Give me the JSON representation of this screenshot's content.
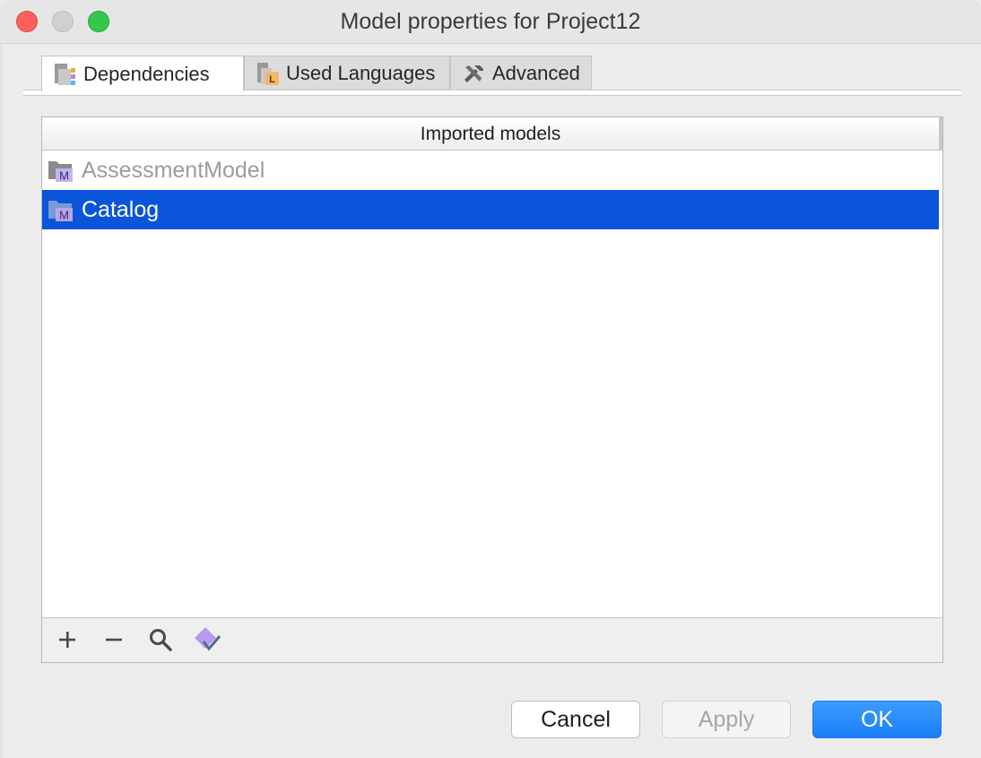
{
  "window": {
    "title": "Model properties for Project12"
  },
  "tabs": [
    {
      "label": "Dependencies",
      "icon": "dependencies-icon",
      "active": true
    },
    {
      "label": "Used Languages",
      "icon": "language-icon",
      "active": false
    },
    {
      "label": "Advanced",
      "icon": "tools-icon",
      "active": false
    }
  ],
  "table": {
    "header": "Imported models",
    "rows": [
      {
        "label": "AssessmentModel",
        "icon": "model-icon",
        "state": "dimmed"
      },
      {
        "label": "Catalog",
        "icon": "model-icon",
        "state": "selected"
      }
    ]
  },
  "toolbar": {
    "add": "add-icon",
    "remove": "remove-icon",
    "search": "search-icon",
    "check": "check-diamond-icon"
  },
  "buttons": {
    "cancel": "Cancel",
    "apply": "Apply",
    "ok": "OK"
  },
  "colors": {
    "selection": "#0a55d9",
    "ok_button": "#1880f6",
    "model_icon": "#7a9ad1",
    "model_badge": "#b9a4ec"
  }
}
